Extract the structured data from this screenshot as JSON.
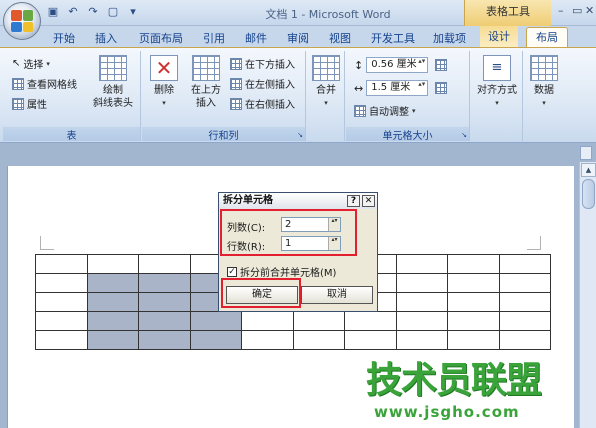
{
  "window": {
    "title": "文档 1 - Microsoft Word",
    "context_tab": "表格工具",
    "controls": [
      "–",
      "▭",
      "✕"
    ]
  },
  "quick_access": {
    "items": [
      "save-icon",
      "undo-icon",
      "redo-icon",
      "new-doc-icon"
    ],
    "dropdown": "▾"
  },
  "tabs": [
    {
      "label": "开始"
    },
    {
      "label": "插入"
    },
    {
      "label": "页面布局"
    },
    {
      "label": "引用"
    },
    {
      "label": "邮件"
    },
    {
      "label": "审阅"
    },
    {
      "label": "视图"
    },
    {
      "label": "开发工具"
    },
    {
      "label": "加载项"
    },
    {
      "label": "设计"
    },
    {
      "label": "布局"
    }
  ],
  "ribbon": {
    "group_table": {
      "label": "表",
      "select": "选择",
      "view_gridlines": "查看网格线",
      "properties": "属性",
      "draw_diagonal_1": "绘制",
      "draw_diagonal_2": "斜线表头"
    },
    "group_rows_cols": {
      "label": "行和列",
      "delete": "删除",
      "insert_above_1": "在上方",
      "insert_above_2": "插入",
      "insert_below": "在下方插入",
      "insert_left": "在左侧插入",
      "insert_right": "在右侧插入"
    },
    "group_merge": {
      "merge": "合并"
    },
    "group_cell_size": {
      "label": "单元格大小",
      "height": "0.56 厘米",
      "width": "1.5 厘米",
      "autofit": "自动调整"
    },
    "group_align": {
      "align": "对齐方式"
    },
    "group_data": {
      "data": "数据"
    }
  },
  "dialog": {
    "title": "拆分单元格",
    "help": "?",
    "close": "✕",
    "columns_label": "列数(C):",
    "columns_value": "2",
    "rows_label": "行数(R):",
    "rows_value": "1",
    "merge_before_split": "拆分前合并单元格(M)",
    "merge_checked": "✓",
    "ok": "确定",
    "cancel": "取消"
  },
  "table": {
    "rows": 5,
    "cols": 10,
    "selected_cells": [
      [
        1,
        1
      ],
      [
        1,
        2
      ],
      [
        1,
        3
      ],
      [
        2,
        1
      ],
      [
        2,
        2
      ],
      [
        2,
        3
      ],
      [
        3,
        1
      ],
      [
        3,
        2
      ],
      [
        3,
        3
      ],
      [
        4,
        1
      ],
      [
        4,
        2
      ],
      [
        4,
        3
      ]
    ]
  },
  "watermark": {
    "text": "技术员联盟",
    "url": "www.jsgho.com"
  }
}
